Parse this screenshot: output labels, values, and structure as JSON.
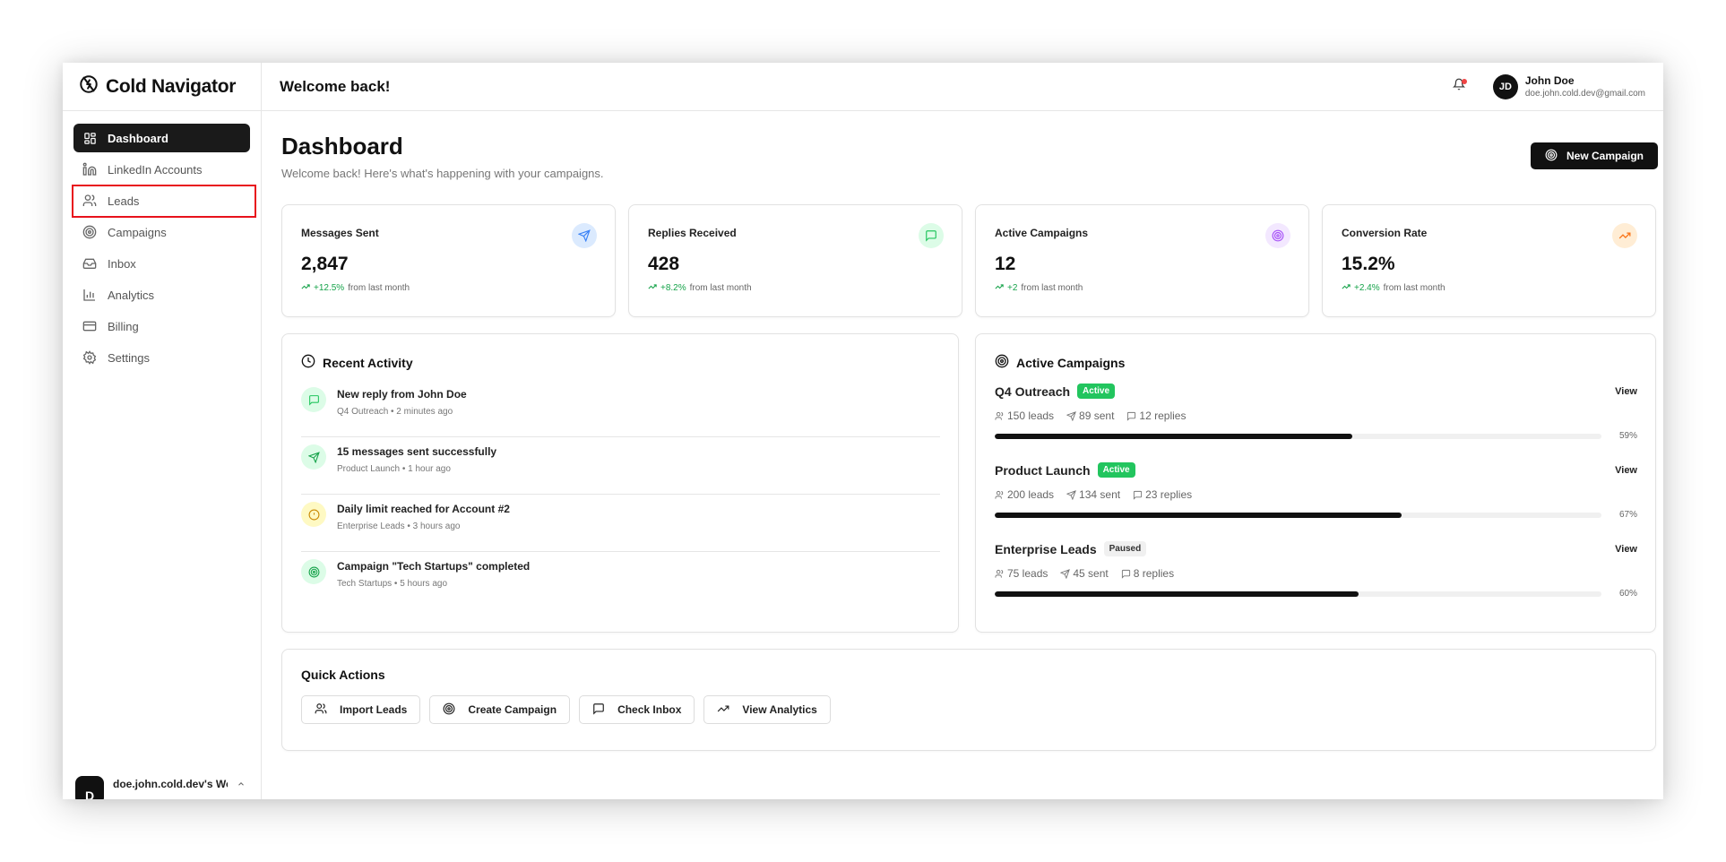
{
  "app": {
    "name": "Cold Navigator"
  },
  "sidebar": {
    "items": [
      {
        "label": "Dashboard",
        "icon": "dashboard-icon",
        "active": true
      },
      {
        "label": "LinkedIn Accounts",
        "icon": "linkedin-icon",
        "active": false
      },
      {
        "label": "Leads",
        "icon": "users-icon",
        "active": false
      },
      {
        "label": "Campaigns",
        "icon": "target-icon",
        "active": false
      },
      {
        "label": "Inbox",
        "icon": "inbox-icon",
        "active": false
      },
      {
        "label": "Analytics",
        "icon": "bar-chart-icon",
        "active": false
      },
      {
        "label": "Billing",
        "icon": "credit-card-icon",
        "active": false
      },
      {
        "label": "Settings",
        "icon": "gear-icon",
        "active": false
      }
    ],
    "workspace": {
      "avatar": "D",
      "name": "doe.john.cold.dev's Wo"
    }
  },
  "header": {
    "title": "Welcome back!",
    "user": {
      "initials": "JD",
      "name": "John Doe",
      "email": "doe.john.cold.dev@gmail.com"
    }
  },
  "page": {
    "title": "Dashboard",
    "subtitle": "Welcome back! Here's what's happening with your campaigns.",
    "new_campaign_label": "New Campaign"
  },
  "stats": [
    {
      "label": "Messages Sent",
      "value": "2,847",
      "change": "+12.5%",
      "suffix": "from last month",
      "icon": "send-icon",
      "color": "#3b82f6",
      "bg": "#dbeafe"
    },
    {
      "label": "Replies Received",
      "value": "428",
      "change": "+8.2%",
      "suffix": "from last month",
      "icon": "message-icon",
      "color": "#22c55e",
      "bg": "#dcfce7"
    },
    {
      "label": "Active Campaigns",
      "value": "12",
      "change": "+2",
      "suffix": "from last month",
      "icon": "target-icon",
      "color": "#a855f7",
      "bg": "#f3e8ff"
    },
    {
      "label": "Conversion Rate",
      "value": "15.2%",
      "change": "+2.4%",
      "suffix": "from last month",
      "icon": "trending-up-icon",
      "color": "#f97316",
      "bg": "#ffedd5"
    }
  ],
  "recent_activity": {
    "title": "Recent Activity",
    "items": [
      {
        "title": "New reply from John Doe",
        "meta": "Q4 Outreach • 2 minutes ago",
        "icon": "message-icon",
        "color": "#22c55e",
        "bg": "#dcfce7"
      },
      {
        "title": "15 messages sent successfully",
        "meta": "Product Launch • 1 hour ago",
        "icon": "send-icon",
        "color": "#16a34a",
        "bg": "#dcfce7"
      },
      {
        "title": "Daily limit reached for Account #2",
        "meta": "Enterprise Leads • 3 hours ago",
        "icon": "alert-icon",
        "color": "#ca8a04",
        "bg": "#fef9c3"
      },
      {
        "title": "Campaign \"Tech Startups\" completed",
        "meta": "Tech Startups • 5 hours ago",
        "icon": "target-icon",
        "color": "#16a34a",
        "bg": "#dcfce7"
      }
    ]
  },
  "active_campaigns": {
    "title": "Active Campaigns",
    "view_label": "View",
    "items": [
      {
        "name": "Q4 Outreach",
        "status": "Active",
        "leads": "150 leads",
        "sent": "89 sent",
        "replies": "12 replies",
        "progress": 59,
        "progress_label": "59%"
      },
      {
        "name": "Product Launch",
        "status": "Active",
        "leads": "200 leads",
        "sent": "134 sent",
        "replies": "23 replies",
        "progress": 67,
        "progress_label": "67%"
      },
      {
        "name": "Enterprise Leads",
        "status": "Paused",
        "leads": "75 leads",
        "sent": "45 sent",
        "replies": "8 replies",
        "progress": 60,
        "progress_label": "60%"
      }
    ]
  },
  "quick_actions": {
    "title": "Quick Actions",
    "buttons": [
      {
        "label": "Import Leads",
        "icon": "users-icon"
      },
      {
        "label": "Create Campaign",
        "icon": "target-icon"
      },
      {
        "label": "Check Inbox",
        "icon": "message-icon"
      },
      {
        "label": "View Analytics",
        "icon": "trending-up-icon"
      }
    ]
  },
  "colors": {
    "accent": "#111111",
    "success": "#22c55e",
    "highlight": "#e8121c",
    "notification": "#ef4444"
  }
}
